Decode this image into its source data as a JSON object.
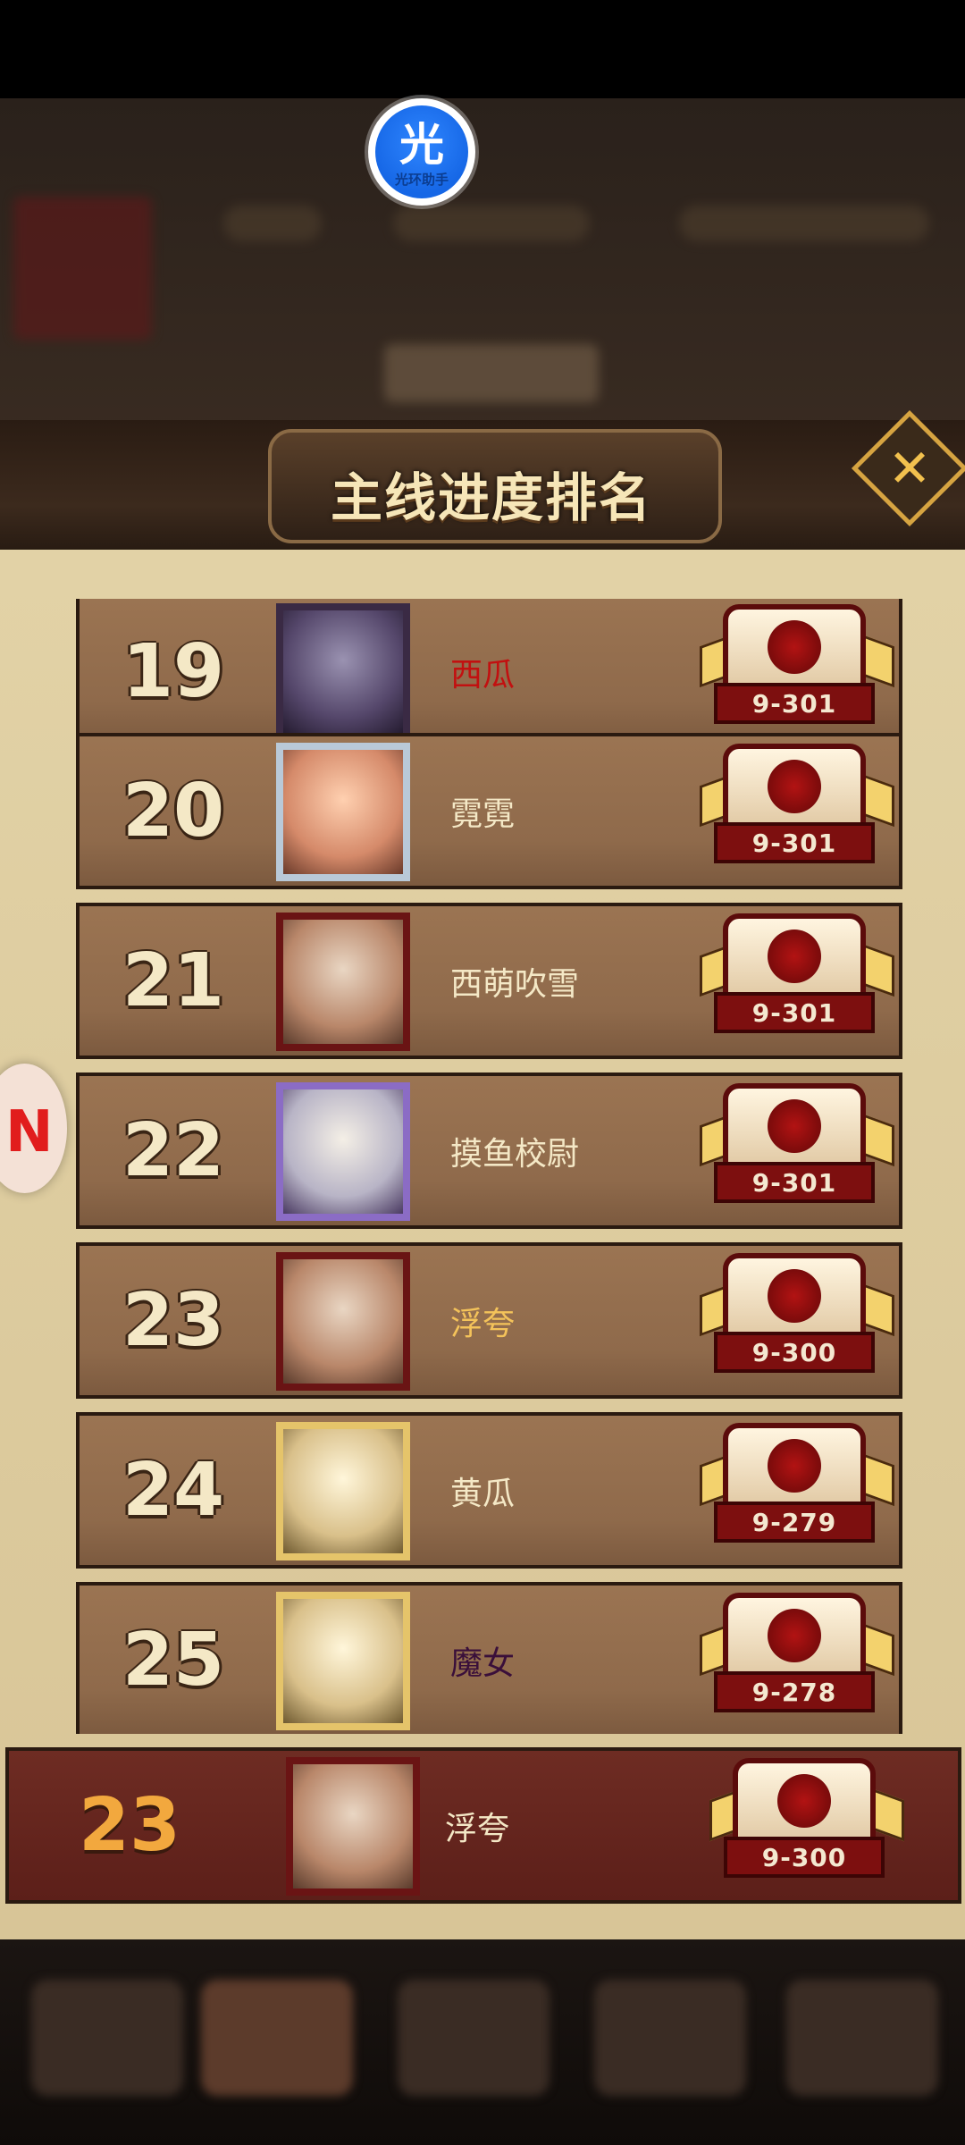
{
  "screen": {
    "title": "主线进度排名",
    "close_icon": "✕",
    "app_badge": {
      "glyph": "光",
      "label": "光环助手"
    },
    "side_bubble_glyph": "N"
  },
  "leaderboard": [
    {
      "rank": "19",
      "name": "西瓜",
      "name_color": "#c21010",
      "avatar_style": "dark",
      "stage": "9-301"
    },
    {
      "rank": "20",
      "name": "霓霓",
      "name_color": "#f4e8c6",
      "avatar_style": "silver",
      "stage": "9-301"
    },
    {
      "rank": "21",
      "name": "西萌吹雪",
      "name_color": "#f4e8c6",
      "avatar_style": "red",
      "stage": "9-301"
    },
    {
      "rank": "22",
      "name": "摸鱼校尉",
      "name_color": "#f4e8c6",
      "avatar_style": "purple",
      "stage": "9-301"
    },
    {
      "rank": "23",
      "name": "浮夸",
      "name_color": "#f4c35a",
      "avatar_style": "red",
      "stage": "9-300"
    },
    {
      "rank": "24",
      "name": "黄瓜",
      "name_color": "#f4e8c6",
      "avatar_style": "gold",
      "stage": "9-279"
    },
    {
      "rank": "25",
      "name": "魔女",
      "name_color": "#3a0f3a",
      "avatar_style": "gold",
      "stage": "9-278"
    }
  ],
  "my_entry": {
    "rank": "23",
    "name": "浮夸",
    "name_color": "#f4e8c6",
    "avatar_style": "red",
    "stage": "9-300"
  }
}
